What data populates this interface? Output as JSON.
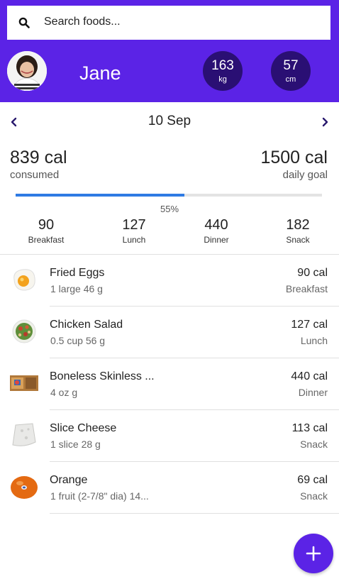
{
  "search": {
    "placeholder": "Search foods..."
  },
  "user": {
    "name": "Jane",
    "avatar": "user-avatar-photo"
  },
  "stats": {
    "weight": {
      "value": "163",
      "unit": "kg"
    },
    "height": {
      "value": "57",
      "unit": "cm"
    }
  },
  "date": {
    "label": "10 Sep"
  },
  "summary": {
    "consumed": "839 cal",
    "consumed_label": "consumed",
    "goal": "1500 cal",
    "goal_label": "daily goal",
    "progress_fraction": 0.55,
    "progress_text": "55%"
  },
  "meals": [
    {
      "value": "90",
      "label": "Breakfast"
    },
    {
      "value": "127",
      "label": "Lunch"
    },
    {
      "value": "440",
      "label": "Dinner"
    },
    {
      "value": "182",
      "label": "Snack"
    }
  ],
  "foods": [
    {
      "name": "Fried Eggs",
      "detail": "1 large 46 g",
      "cal": "90 cal",
      "meal": "Breakfast",
      "icon": "fried-egg-photo"
    },
    {
      "name": "Chicken Salad",
      "detail": "0.5 cup 56 g",
      "cal": "127 cal",
      "meal": "Lunch",
      "icon": "salad-photo"
    },
    {
      "name": "Boneless Skinless ...",
      "detail": "4 oz g",
      "cal": "440 cal",
      "meal": "Dinner",
      "icon": "meat-package-photo"
    },
    {
      "name": "Slice Cheese",
      "detail": "1 slice 28 g",
      "cal": "113 cal",
      "meal": "Snack",
      "icon": "cheese-slice-photo"
    },
    {
      "name": "Orange",
      "detail": "1 fruit (2-7/8\" dia) 14...",
      "cal": "69 cal",
      "meal": "Snack",
      "icon": "orange-photo"
    }
  ],
  "icons": {
    "search": "search-icon",
    "prev": "chevron-left-icon",
    "next": "chevron-right-icon",
    "add": "plus-icon"
  },
  "colors": {
    "primary": "#5b23e6",
    "stat_circle": "#2a0f74",
    "progress": "#2f7be3"
  }
}
